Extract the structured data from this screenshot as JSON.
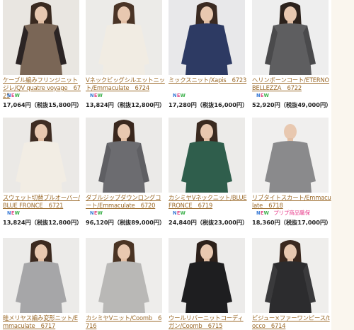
{
  "colors": {
    "link": "#9b6a2a",
    "new_n": "#3a7bd5",
    "new_e": "#e0508a",
    "new_w": "#3bb04a",
    "pink": "#e83e8c"
  },
  "products": [
    {
      "title": "ケーブル編みフリンジニットジレ/QV quatre voyage　6725",
      "new": true,
      "price": "17,064円（税抜15,800円）",
      "photo": {
        "bg": "#e9e6e1",
        "garment": "#7a6656",
        "sleeve": "#2b2424",
        "hair": "#3a2a20"
      }
    },
    {
      "title": "Vネックビッグシルエットニット/Emmaculate　6724",
      "new": true,
      "price": "13,824円（税抜12,800円）",
      "photo": {
        "bg": "#ecebe8",
        "garment": "#f1ece3",
        "sleeve": "#f1ece3",
        "hair": "#4a3426"
      }
    },
    {
      "title": "ミックスニット/Xapis　6723",
      "new": true,
      "price": "17,280円（税抜16,000円）",
      "photo": {
        "bg": "#e8e8ea",
        "garment": "#2d3a63",
        "sleeve": "#2d3a63",
        "hair": "#3a2a22"
      }
    },
    {
      "title": "ヘリンボーンコート/ETERNO BELLEZZA　6722",
      "new": true,
      "price": "52,920円（税抜49,000円）",
      "photo": {
        "bg": "#eeeeee",
        "garment": "#5e5e60",
        "sleeve": "#4a4a4c",
        "hair": "#2c221c"
      }
    },
    {
      "title": "スウェット切替プルオーバー/BLUE FRONCE　6721",
      "new": true,
      "price": "13,824円（税抜12,800円）",
      "photo": {
        "bg": "#ebe9e6",
        "garment": "#f2ede4",
        "sleeve": "#f2ede4",
        "hair": "#3e2c22"
      }
    },
    {
      "title": "ダブルジップダウンロングコート/Emmaculate　6720",
      "new": true,
      "price": "96,120円（税抜89,000円）",
      "photo": {
        "bg": "#ebeae8",
        "garment": "#6c6c70",
        "sleeve": "#5f5f63",
        "hair": "#3a281e"
      }
    },
    {
      "title": "カシミヤVネックニット/BLUE FRONCE　6719",
      "new": true,
      "price": "24,840円（税抜23,000円）",
      "photo": {
        "bg": "#ecebe9",
        "garment": "#2f5e4c",
        "sleeve": "#2f5e4c",
        "hair": "#3a2a20"
      }
    },
    {
      "title": "リブタイトスカート/Emmaculate　6718",
      "new": true,
      "pink": "プリプ商品職保",
      "price": "18,360円（税抜17,000円）",
      "photo": {
        "bg": "#f0efee",
        "garment": "#8a8a8c",
        "sleeve": "#8a8a8c",
        "hair": "#f0efee"
      }
    },
    {
      "title": "畦メリヤス編み変形ニット/Emmaculate　6717",
      "new": false,
      "price": "",
      "photo": {
        "bg": "#ecebe9",
        "garment": "#a6a6a8",
        "sleeve": "#a6a6a8",
        "hair": "#3c2a20"
      }
    },
    {
      "title": "カシミヤVニット/Coomb　6716",
      "new": false,
      "price": "",
      "photo": {
        "bg": "#eeedeb",
        "garment": "#b9b8b6",
        "sleeve": "#b9b8b6",
        "hair": "#4a3424"
      }
    },
    {
      "title": "ウールリバーニットコーディガン/Coomb　6715",
      "new": false,
      "price": "",
      "photo": {
        "bg": "#ecebea",
        "garment": "#1e1e20",
        "sleeve": "#1e1e20",
        "hair": "#2c201a"
      }
    },
    {
      "title": "ビジュー×ファーワンピース/tocco　6714",
      "new": false,
      "price": "",
      "photo": {
        "bg": "#efeeec",
        "garment": "#2c2c2e",
        "sleeve": "#3a3a3c",
        "hair": "#3a281e"
      }
    }
  ]
}
